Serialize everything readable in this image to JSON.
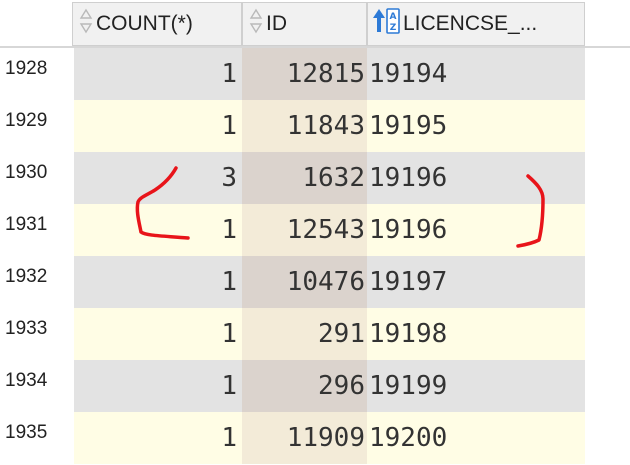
{
  "columns": [
    {
      "label": "COUNT(*)",
      "icon": "sort-icon"
    },
    {
      "label": "ID",
      "icon": "sort-icon"
    },
    {
      "label": "LICENCSE_...",
      "icon": "sort-az-icon"
    }
  ],
  "rows": [
    {
      "num": "1928",
      "count": "1",
      "id": "12815",
      "licence": "19194"
    },
    {
      "num": "1929",
      "count": "1",
      "id": "11843",
      "licence": "19195"
    },
    {
      "num": "1930",
      "count": "3",
      "id": "1632",
      "licence": "19196"
    },
    {
      "num": "1931",
      "count": "1",
      "id": "12543",
      "licence": "19196"
    },
    {
      "num": "1932",
      "count": "1",
      "id": "10476",
      "licence": "19197"
    },
    {
      "num": "1933",
      "count": "1",
      "id": "291",
      "licence": "19198"
    },
    {
      "num": "1934",
      "count": "1",
      "id": "296",
      "licence": "19199"
    },
    {
      "num": "1935",
      "count": "1",
      "id": "11909",
      "licence": "19200"
    }
  ],
  "colors": {
    "annotation": "#e8141a",
    "row_even": "#e3e3e3",
    "row_odd": "#fffde5",
    "id_even": "#dbd3cd",
    "id_odd": "#f3ebd8"
  }
}
